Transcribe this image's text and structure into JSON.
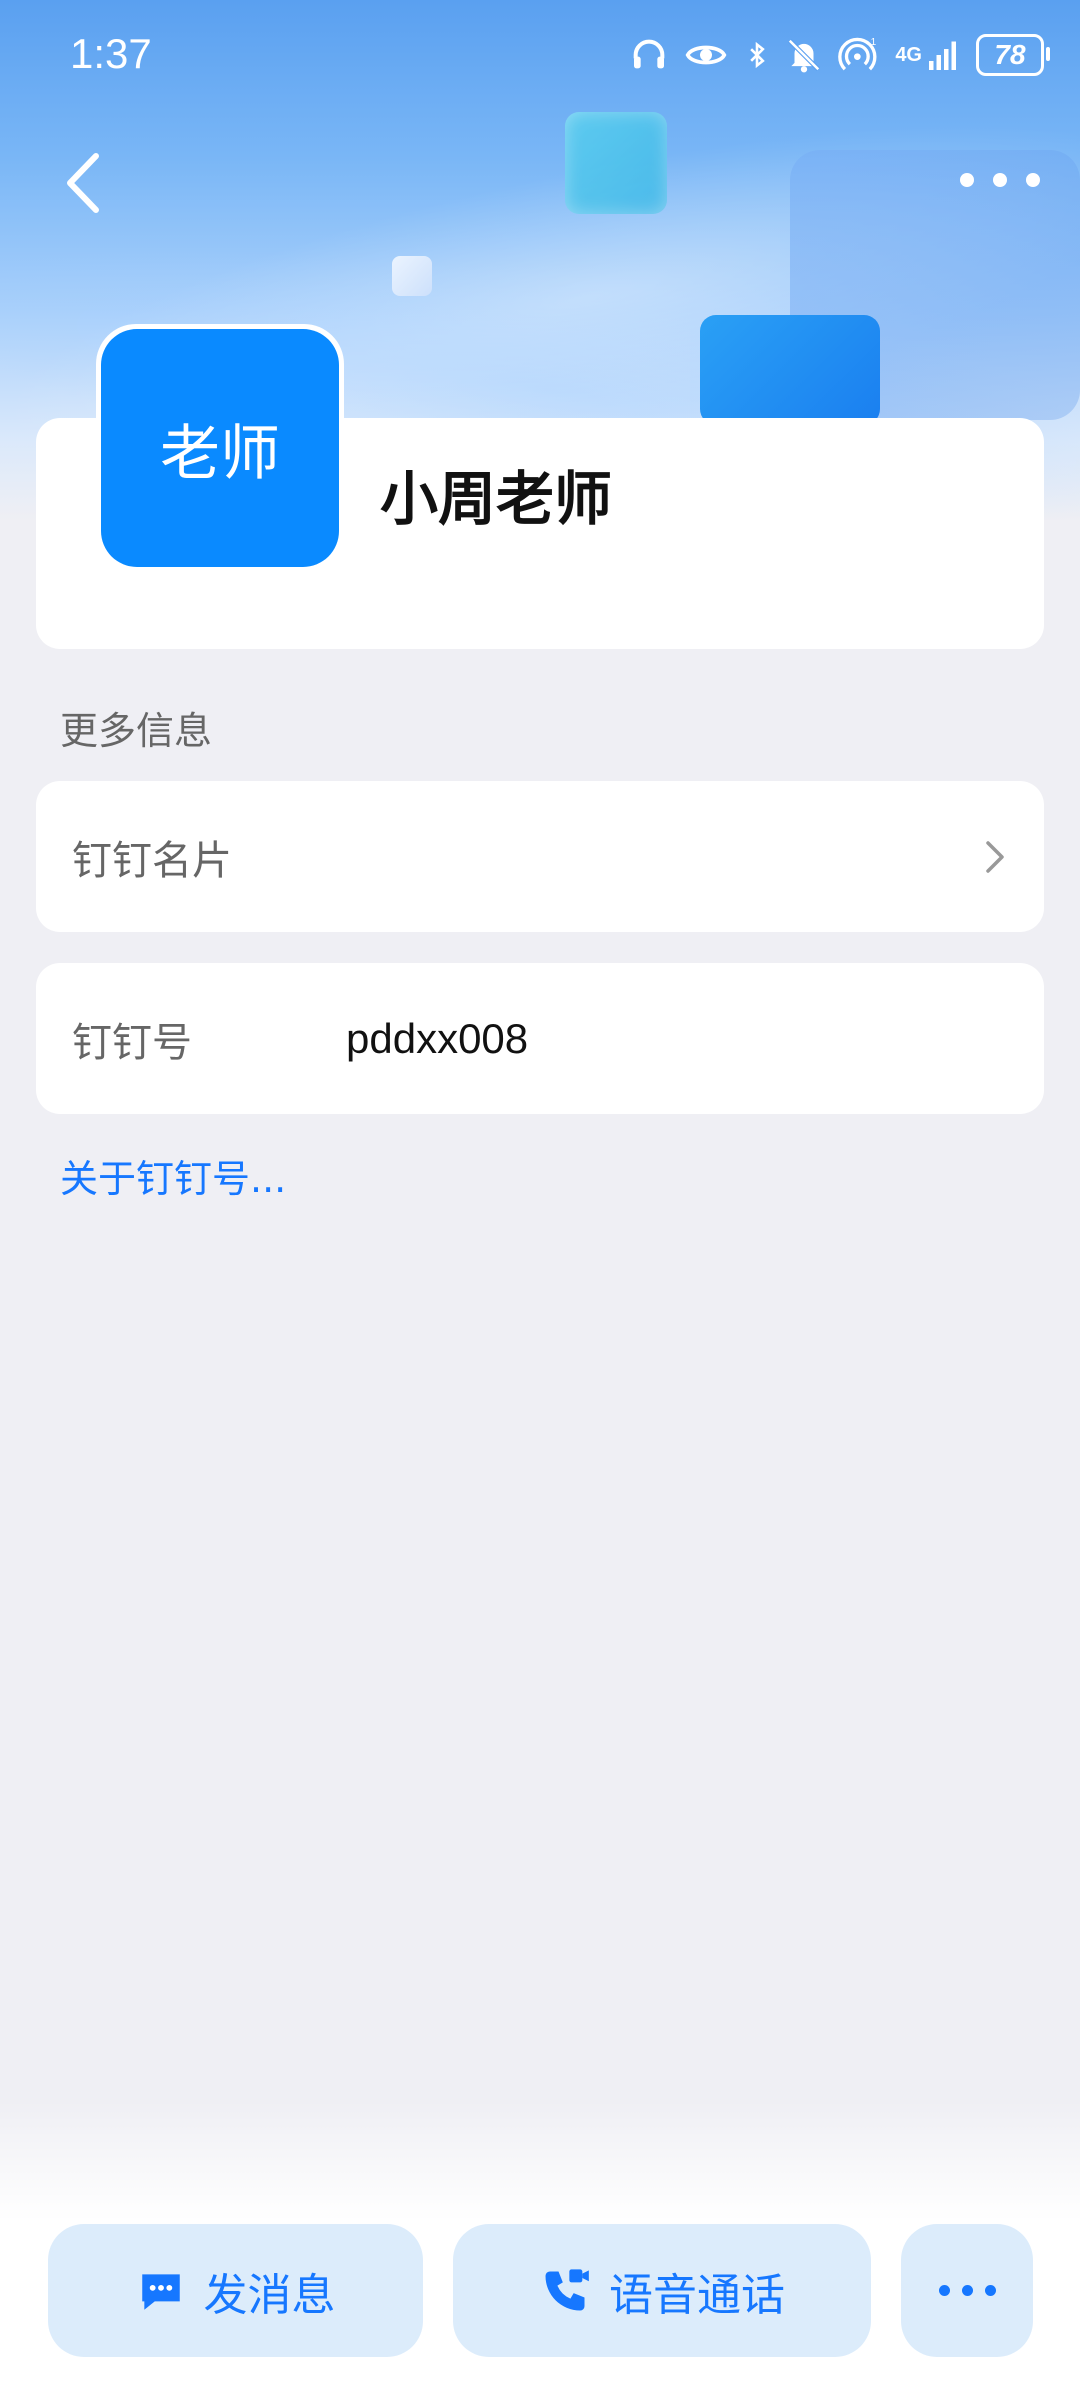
{
  "status_bar": {
    "time": "1:37",
    "battery": "78",
    "signal_text": "4G",
    "icons": [
      "headphones-icon",
      "eye-icon",
      "bluetooth-icon",
      "bell-off-icon",
      "hotspot-icon",
      "signal-icon",
      "battery-icon"
    ]
  },
  "nav": {
    "back_icon": "chevron-left-icon",
    "more_icon": "more-icon"
  },
  "profile": {
    "avatar_text": "老师",
    "name": "小周老师",
    "avatar_color": "#0a8aff"
  },
  "more_info": {
    "section_label": "更多信息",
    "card_label": "钉钉名片",
    "id_label": "钉钉号",
    "id_value": "pddxx008",
    "about_link": "关于钉钉号..."
  },
  "actions": {
    "message": "发消息",
    "voice_call": "语音通话",
    "more_icon": "more-horizontal-icon"
  },
  "colors": {
    "accent": "#1677ff",
    "button_bg": "#dcecfb",
    "page_bg": "#efeff4"
  }
}
